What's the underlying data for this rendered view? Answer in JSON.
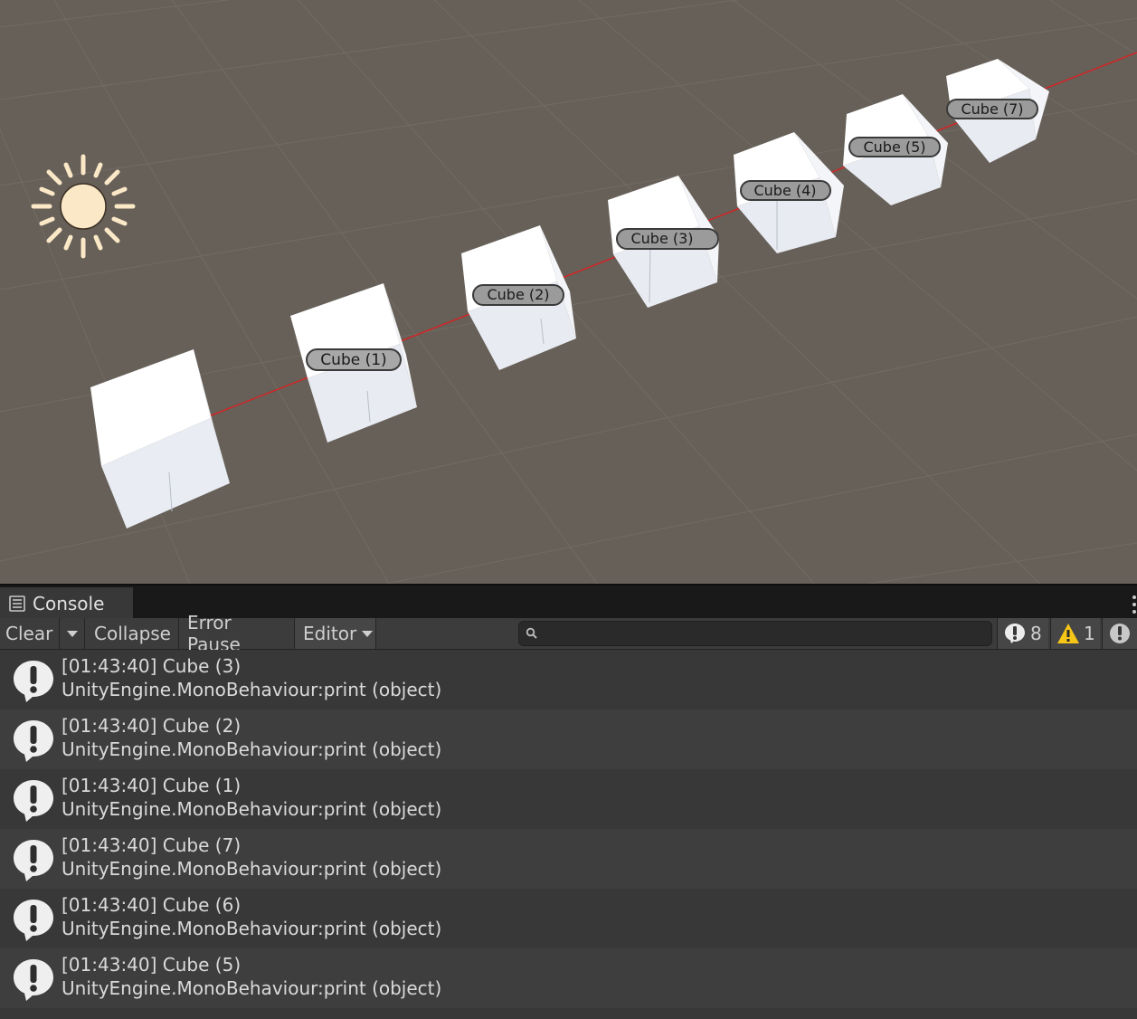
{
  "scene": {
    "cube_labels": [
      "Cube (1)",
      "Cube (2)",
      "Cube (3)",
      "Cube (4)",
      "Cube (5)",
      "Cube (7)"
    ],
    "line_color": "#d42424",
    "background_color": "#666059"
  },
  "console": {
    "tab_label": "Console",
    "toolbar": {
      "clear_label": "Clear",
      "collapse_label": "Collapse",
      "error_pause_label": "Error Pause",
      "editor_label": "Editor",
      "search_placeholder": "",
      "info_count": "8",
      "warning_count": "1",
      "error_count": ""
    },
    "logs": [
      {
        "line1": "[01:43:40] Cube (3)",
        "line2": "UnityEngine.MonoBehaviour:print (object)"
      },
      {
        "line1": "[01:43:40] Cube (2)",
        "line2": "UnityEngine.MonoBehaviour:print (object)"
      },
      {
        "line1": "[01:43:40] Cube (1)",
        "line2": "UnityEngine.MonoBehaviour:print (object)"
      },
      {
        "line1": "[01:43:40] Cube (7)",
        "line2": "UnityEngine.MonoBehaviour:print (object)"
      },
      {
        "line1": "[01:43:40] Cube (6)",
        "line2": "UnityEngine.MonoBehaviour:print (object)"
      },
      {
        "line1": "[01:43:40] Cube (5)",
        "line2": "UnityEngine.MonoBehaviour:print (object)"
      }
    ]
  }
}
